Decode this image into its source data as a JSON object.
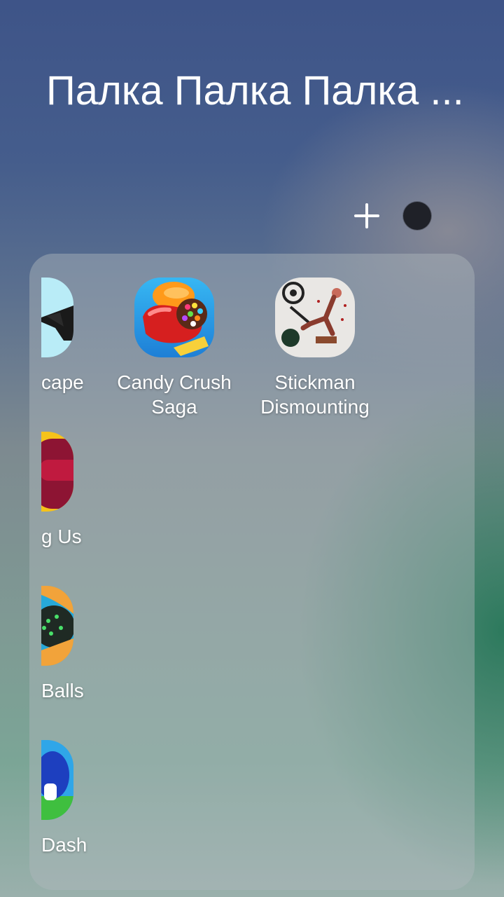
{
  "folder": {
    "title": "Палка Палка Палка ..."
  },
  "controls": {
    "add_icon": "plus-icon",
    "color_dot_color": "#1f2128"
  },
  "apps": [
    {
      "label": "Candy Crush\nSaga",
      "icon": "candy-crush-icon"
    },
    {
      "label": "Stickman\nDismounting",
      "icon": "stickman-icon"
    }
  ],
  "clipped_apps": [
    {
      "label": "cape",
      "icon": "escape-game-icon"
    },
    {
      "label": "g Us",
      "icon": "among-us-icon"
    },
    {
      "label": "Balls",
      "icon": "balls-game-icon"
    },
    {
      "label": "Dash",
      "icon": "dash-game-icon"
    }
  ]
}
